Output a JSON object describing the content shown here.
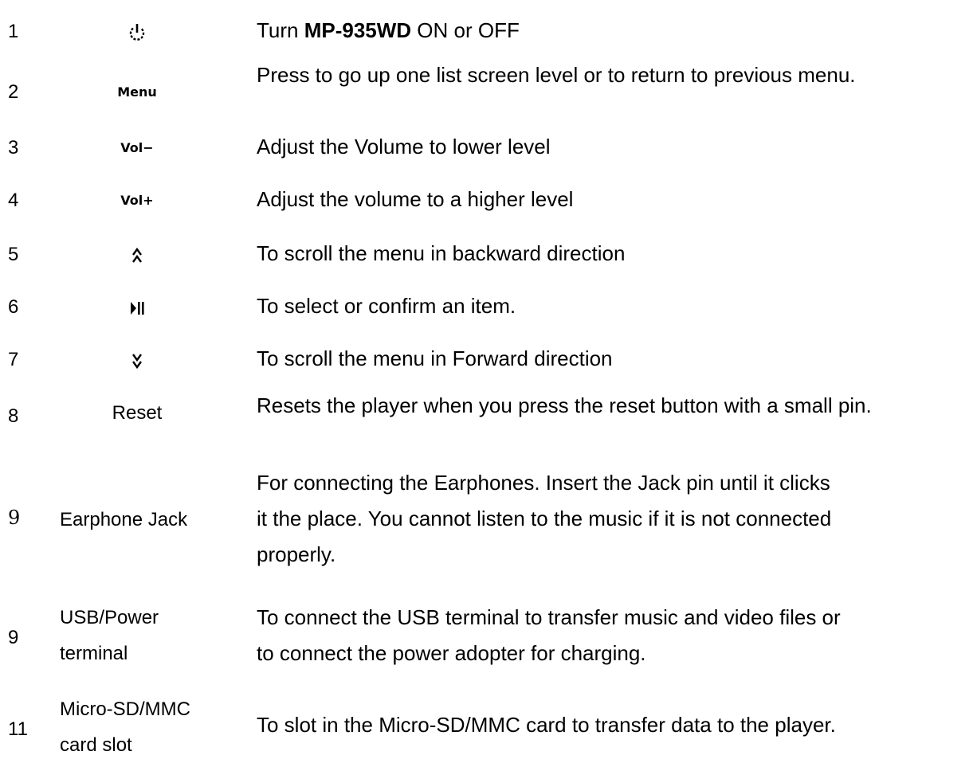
{
  "rows": [
    {
      "number": "1",
      "symbol_icon": "power-icon",
      "description_prefix": "Turn ",
      "description_bold": "MP-935WD",
      "description_suffix": " ON or OFF"
    },
    {
      "number": "2",
      "symbol_text": "Menu",
      "description": "Press to go up one list screen level or to return to previous menu."
    },
    {
      "number": "3",
      "symbol_text": "Vol−",
      "description": "Adjust the Volume to lower level"
    },
    {
      "number": "4",
      "symbol_text": "Vol+",
      "description": "Adjust the volume to a higher level"
    },
    {
      "number": "5",
      "symbol_icon": "double-chevron-up-icon",
      "description": "To scroll the menu in backward direction"
    },
    {
      "number": "6",
      "symbol_icon": "play-pause-icon",
      "description": "To select or confirm an item."
    },
    {
      "number": "7",
      "symbol_icon": "double-chevron-down-icon",
      "description": "To scroll the menu in Forward direction"
    },
    {
      "number": "8",
      "symbol_text": "Reset",
      "description": "Resets the player when you press the reset button with a small pin."
    },
    {
      "number": "9",
      "label": "Earphone Jack",
      "description_lines": [
        "For connecting the Earphones. Insert the Jack pin until it clicks",
        "it the place. You cannot listen to the music if it is not connected",
        "properly."
      ]
    },
    {
      "number": "9",
      "label_lines": [
        "USB/Power",
        "terminal"
      ],
      "description_lines": [
        "To connect the USB terminal to transfer music and video files or",
        "to connect the power adopter for charging."
      ]
    },
    {
      "number": "11",
      "label_lines": [
        "Micro-SD/MMC",
        "card slot"
      ],
      "description": "To slot in the Micro-SD/MMC card to transfer data to the player."
    }
  ]
}
